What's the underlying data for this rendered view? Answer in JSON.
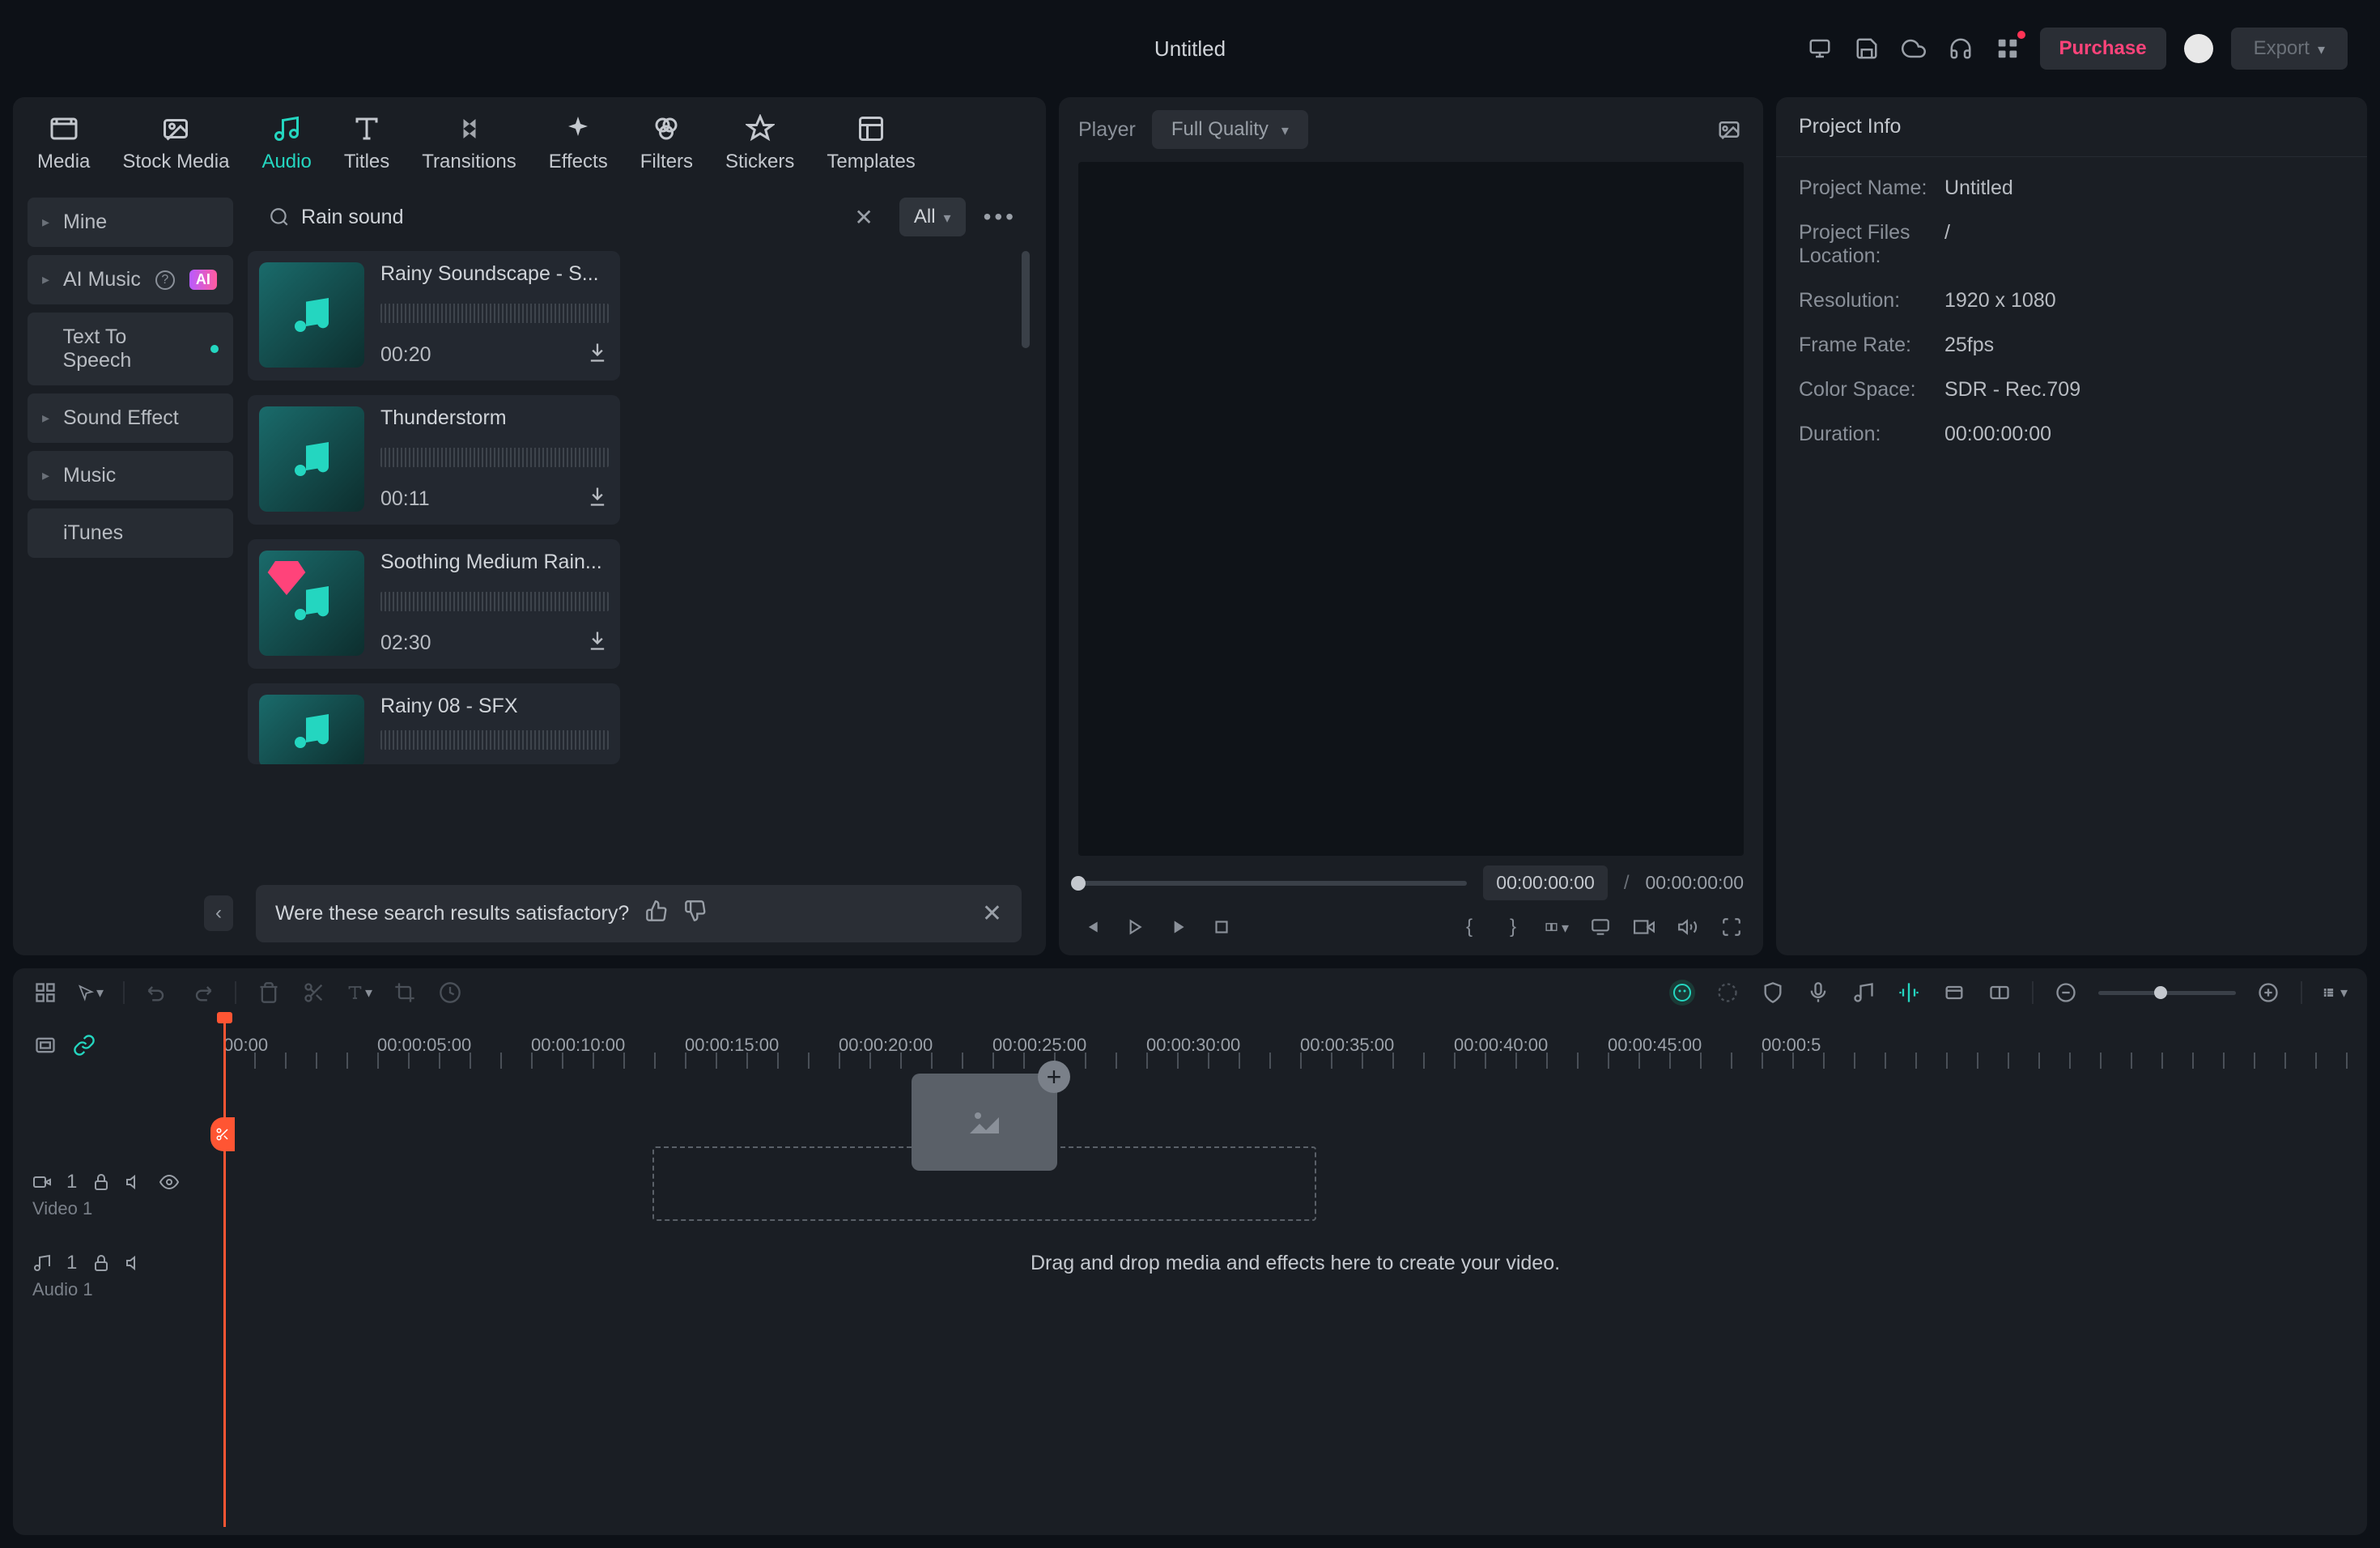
{
  "titlebar": {
    "title": "Untitled",
    "purchase_label": "Purchase",
    "export_label": "Export"
  },
  "tabs": [
    {
      "label": "Media",
      "icon": "film"
    },
    {
      "label": "Stock Media",
      "icon": "image"
    },
    {
      "label": "Audio",
      "icon": "music",
      "active": true
    },
    {
      "label": "Titles",
      "icon": "text"
    },
    {
      "label": "Transitions",
      "icon": "swap"
    },
    {
      "label": "Effects",
      "icon": "sparkle"
    },
    {
      "label": "Filters",
      "icon": "circles"
    },
    {
      "label": "Stickers",
      "icon": "sticker"
    },
    {
      "label": "Templates",
      "icon": "template"
    }
  ],
  "sidebar": {
    "items": [
      {
        "label": "Mine",
        "expandable": true
      },
      {
        "label": "AI Music",
        "expandable": true,
        "help": true,
        "ai_badge": true
      },
      {
        "label": "Text To Speech",
        "green_dot": true
      },
      {
        "label": "Sound Effect",
        "expandable": true
      },
      {
        "label": "Music",
        "expandable": true
      },
      {
        "label": "iTunes"
      }
    ]
  },
  "search": {
    "value": "Rain sound",
    "filter_label": "All"
  },
  "results": [
    {
      "title": "Rainy Soundscape - S...",
      "duration": "00:20"
    },
    {
      "title": "Thunderstorm",
      "duration": "00:11"
    },
    {
      "title": "Soothing Medium Rain...",
      "duration": "02:30",
      "gem": true
    },
    {
      "title": "Rainy 08 - SFX",
      "duration": ""
    }
  ],
  "feedback": {
    "text": "Were these search results satisfactory?"
  },
  "player": {
    "label": "Player",
    "quality": "Full Quality",
    "time_current": "00:00:00:00",
    "time_total": "00:00:00:00",
    "time_sep": "/"
  },
  "project_info": {
    "header": "Project Info",
    "rows": [
      {
        "label": "Project Name:",
        "value": "Untitled"
      },
      {
        "label": "Project Files Location:",
        "value": "/"
      },
      {
        "label": "Resolution:",
        "value": "1920 x 1080"
      },
      {
        "label": "Frame Rate:",
        "value": "25fps"
      },
      {
        "label": "Color Space:",
        "value": "SDR - Rec.709"
      },
      {
        "label": "Duration:",
        "value": "00:00:00:00"
      }
    ]
  },
  "ruler": {
    "marks": [
      "00:00",
      "00:00:05:00",
      "00:00:10:00",
      "00:00:15:00",
      "00:00:20:00",
      "00:00:25:00",
      "00:00:30:00",
      "00:00:35:00",
      "00:00:40:00",
      "00:00:45:00",
      "00:00:5"
    ]
  },
  "tracks": {
    "video": {
      "label": "Video 1",
      "index": "1"
    },
    "audio": {
      "label": "Audio 1",
      "index": "1"
    }
  },
  "drop_text": "Drag and drop media and effects here to create your video."
}
